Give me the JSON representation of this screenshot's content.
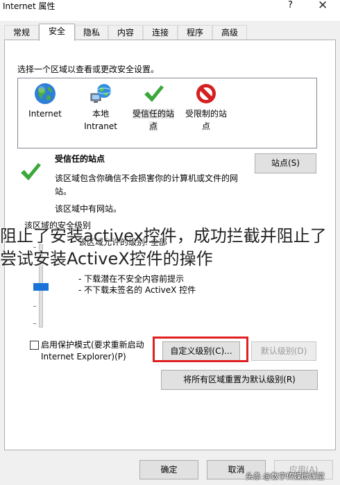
{
  "window": {
    "title": "Internet 属性",
    "help": "?",
    "close": "✕"
  },
  "tabs": [
    {
      "label": "常规"
    },
    {
      "label": "安全"
    },
    {
      "label": "隐私"
    },
    {
      "label": "内容"
    },
    {
      "label": "连接"
    },
    {
      "label": "程序"
    },
    {
      "label": "高级"
    }
  ],
  "security": {
    "instruction": "选择一个区域以查看或更改安全设置。",
    "zones": [
      {
        "line1": "Internet",
        "line2": "",
        "icon": "globe-icon"
      },
      {
        "line1": "本地",
        "line2": "Intranet",
        "icon": "network-globe-icon"
      },
      {
        "line1": "受信任的站",
        "line2": "点",
        "icon": "checkmark-icon"
      },
      {
        "line1": "受限制的站",
        "line2": "点",
        "icon": "prohibited-icon"
      }
    ],
    "selected_zone": {
      "name": "受信任的站点",
      "desc_line1": "该区域包含你确信不会损害你的计算机或文件的网",
      "desc_line2": "站。",
      "has_sites": "该区域中有网站。"
    },
    "sites_button": "站点(S)",
    "level_title": "该区域的安全级别",
    "allowed_levels": "该区域允许的级别: 全部",
    "level_bullets": [
      "- 下载潜在不安全内容前提示",
      "- 不下载未签名的 ActiveX 控件"
    ],
    "protected_mode_line1": "启用保护模式(要求重新启动",
    "protected_mode_line2": "Internet Explorer)(P)",
    "custom_level_button": "自定义级别(C)...",
    "default_level_button": "默认级别(D)",
    "reset_all_button": "将所有区域重置为默认级别(R)"
  },
  "footer": {
    "ok": "确定",
    "cancel": "取消",
    "apply": "应用(A)"
  },
  "overlay_caption": {
    "line1": "阻止了安装activex控件，成功拦截并阻止了",
    "line2": "尝试安装ActiveX控件的操作"
  },
  "watermark": "头条 @数字传媒微课堂",
  "colors": {
    "highlight_box": "#e02020",
    "slider_thumb": "#1a73d8",
    "check_green": "#3aa83a",
    "prohibit_red": "#d42020"
  }
}
